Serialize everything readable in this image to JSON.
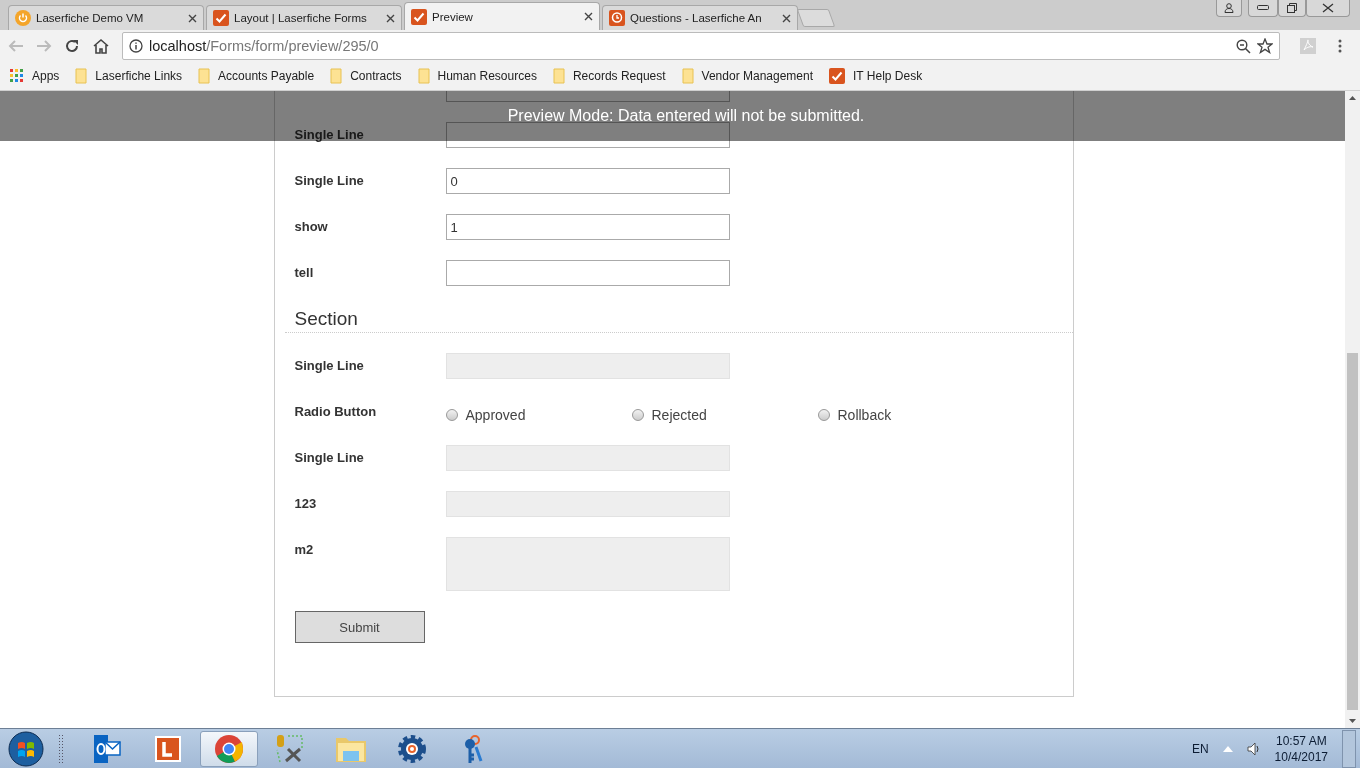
{
  "browser": {
    "tabs": [
      {
        "title": "Laserfiche Demo VM",
        "kind": "power",
        "selected": false
      },
      {
        "title": "Layout | Laserfiche Forms",
        "kind": "check",
        "selected": false
      },
      {
        "title": "Preview",
        "kind": "check",
        "selected": true
      },
      {
        "title": "Questions - Laserfiche An",
        "kind": "clock",
        "selected": false
      }
    ],
    "address": {
      "host": "localhost",
      "path": "/Forms/form/preview/295/0"
    },
    "bookmarks": [
      {
        "label": "Apps",
        "kind": "apps"
      },
      {
        "label": "Laserfiche Links",
        "kind": "folder"
      },
      {
        "label": "Accounts Payable",
        "kind": "folder"
      },
      {
        "label": "Contracts",
        "kind": "folder"
      },
      {
        "label": "Human Resources",
        "kind": "folder"
      },
      {
        "label": "Records Request",
        "kind": "folder"
      },
      {
        "label": "Vendor Management",
        "kind": "folder"
      },
      {
        "label": "IT Help Desk",
        "kind": "check"
      }
    ]
  },
  "banner": "Preview Mode: Data entered will not be submitted.",
  "form": {
    "fields": [
      {
        "kind": "text",
        "label": "Single Line",
        "disabled": false
      },
      {
        "kind": "text",
        "label": "Single Line",
        "value": "0",
        "disabled": false
      },
      {
        "kind": "text",
        "label": "show",
        "value": "1",
        "disabled": false
      },
      {
        "kind": "text",
        "label": "tell",
        "disabled": false
      },
      {
        "kind": "section",
        "label": "Section"
      },
      {
        "kind": "text",
        "label": "Single Line",
        "disabled": true
      },
      {
        "kind": "radio",
        "label": "Radio Button",
        "options": [
          {
            "label": "Approved",
            "selected": false
          },
          {
            "label": "Rejected",
            "selected": false
          },
          {
            "label": "Rollback",
            "selected": false
          }
        ]
      },
      {
        "kind": "text",
        "label": "Single Line",
        "disabled": true
      },
      {
        "kind": "text",
        "label": "123",
        "disabled": true
      },
      {
        "kind": "textarea",
        "label": "m2",
        "disabled": true
      }
    ],
    "submit": "Submit"
  },
  "taskbar": {
    "apps": [
      {
        "kind": "outlook",
        "selected": false
      },
      {
        "kind": "letter",
        "selected": false
      },
      {
        "kind": "chrome",
        "selected": true
      },
      {
        "kind": "tools",
        "selected": false
      },
      {
        "kind": "folder",
        "selected": false
      },
      {
        "kind": "gear",
        "selected": false
      },
      {
        "kind": "keys",
        "selected": false
      }
    ],
    "language": "EN",
    "time": "10:57 AM",
    "date": "10/4/2017"
  }
}
